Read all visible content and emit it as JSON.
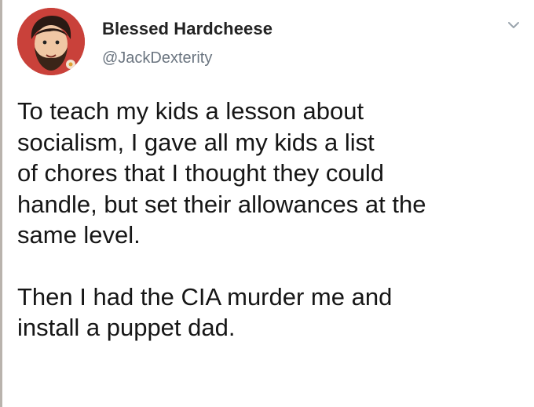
{
  "tweet": {
    "author": {
      "display_name": "Blessed Hardcheese",
      "handle": "@JackDexterity",
      "avatar_icon": "avatar-illustration-bearded-man"
    },
    "menu_icon": "chevron-down-icon",
    "body": {
      "paragraph_1": "To teach my kids a lesson about\nsocialism, I gave all my kids a list\nof chores that I thought they could\nhandle, but set their allowances at the\nsame level.",
      "paragraph_2": "Then I had the CIA murder me and\ninstall a puppet dad."
    }
  },
  "colors": {
    "text": "#161616",
    "handle": "#6b7580",
    "avatar_background": "#c9413a"
  }
}
